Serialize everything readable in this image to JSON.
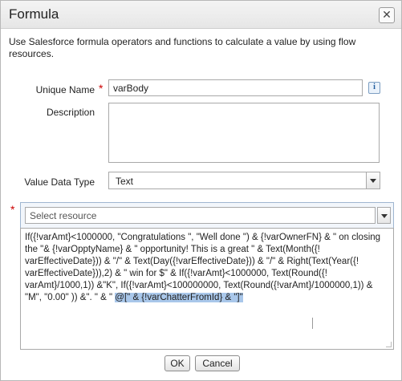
{
  "dialog": {
    "title": "Formula",
    "close_icon": "close-icon",
    "description": "Use Salesforce formula operators and functions to calculate a value by using flow resources."
  },
  "fields": {
    "unique_name_label": "Unique Name",
    "unique_name_value": "varBody",
    "info_icon": "info-icon",
    "info_glyph": "i",
    "description_label": "Description",
    "description_value": "",
    "value_type_label": "Value Data Type",
    "value_type_value": "Text"
  },
  "resource": {
    "placeholder": "Select resource",
    "required_marker": "*"
  },
  "formula": {
    "text_plain": "If({!varAmt}<1000000, \"Congratulations \", \"Well done \") & {!varOwnerFN} & \" on closing the \"& {!varOpptyName} & \" opportunity!  This is a great \" & Text(Month({! varEffectiveDate})) & \"/\" & Text(Day({!varEffectiveDate})) & \"/\" & Right(Text(Year({! varEffectiveDate})),2) & \" win for $\" &  If({!varAmt}<1000000, Text(Round({! varAmt}/1000,1)) &\"K\",  If({!varAmt}<100000000, Text(Round({!varAmt}/1000000,1)) & \"M\", \"0.00\" )) &\".  \" & \" ",
    "text_highlighted": "@[\" &  {!varChatterFromId} & \"]\""
  },
  "buttons": {
    "ok": "OK",
    "cancel": "Cancel"
  },
  "colors": {
    "required": "#cc0000",
    "highlight": "#a9c7ea",
    "panel_border": "#9fb6d0"
  }
}
